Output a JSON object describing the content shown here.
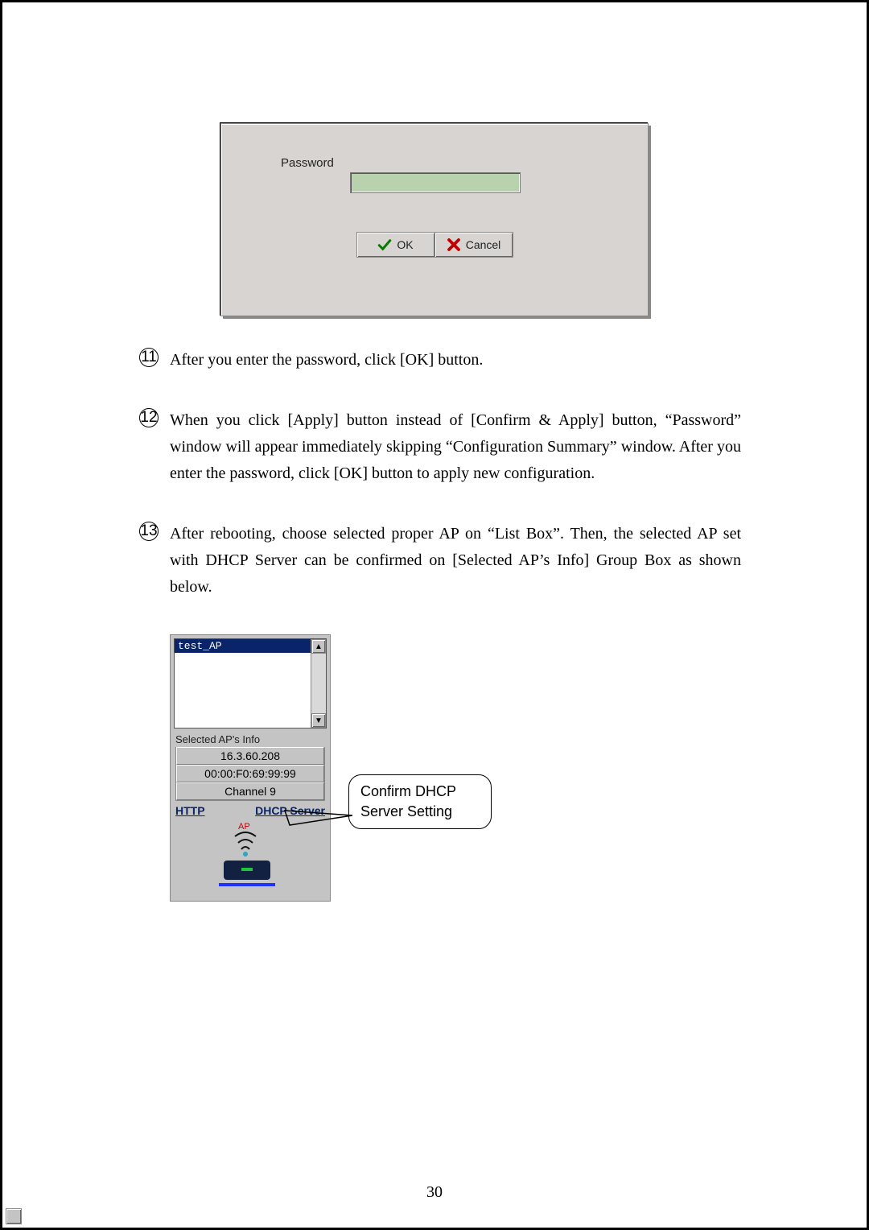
{
  "password_dialog": {
    "label": "Password",
    "ok": "OK",
    "cancel": "Cancel"
  },
  "instructions": [
    {
      "num": "11",
      "text": "After you enter the password, click [OK] button."
    },
    {
      "num": "12",
      "text": "When you click [Apply] button instead of [Confirm & Apply] button, “Password” window will appear immediately skipping “Configuration Summary” window. After you enter the password, click [OK] button to apply new configuration."
    },
    {
      "num": "13",
      "text": "After rebooting, choose selected proper AP on “List Box”. Then, the selected AP set with DHCP Server can be confirmed on [Selected AP’s Info] Group Box as shown below."
    }
  ],
  "ap_panel": {
    "selected_name": "test_AP",
    "group_label": "Selected AP's Info",
    "ip": "16.3.60.208",
    "mac": "00:00:F0:69:99:99",
    "channel": "Channel 9",
    "http_label": "HTTP",
    "dhcp_label": "DHCP Server",
    "ap_text": "AP"
  },
  "callout": {
    "line1": "Confirm DHCP",
    "line2": "Server Setting"
  },
  "page_number": "30"
}
